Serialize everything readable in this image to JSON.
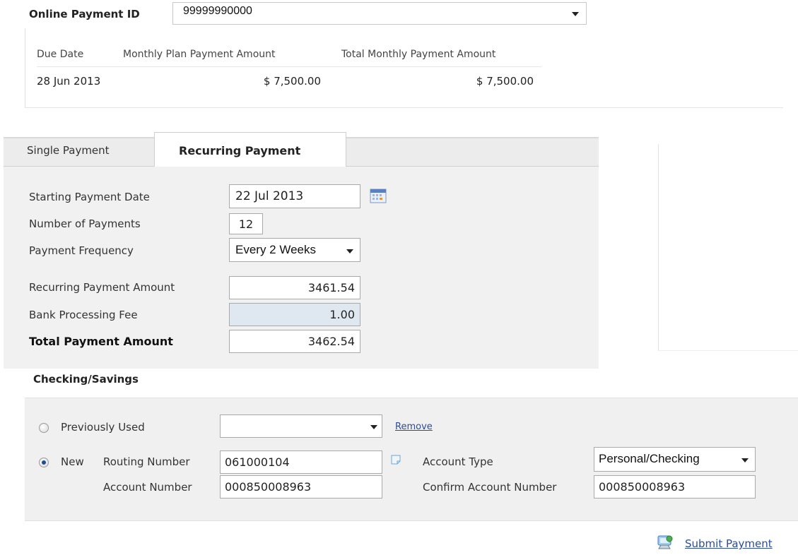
{
  "header": {
    "pid_label": "Online Payment ID",
    "pid_value": "99999990000"
  },
  "due_table": {
    "columns": [
      "Due Date",
      "Monthly Plan Payment Amount",
      "Total Monthly Payment Amount"
    ],
    "rows": [
      [
        "28 Jun 2013",
        "$ 7,500.00",
        "$ 7,500.00"
      ]
    ]
  },
  "tabs": [
    {
      "label": "Single Payment",
      "active": false
    },
    {
      "label": "Recurring Payment",
      "active": true
    }
  ],
  "recurring": {
    "start_label": "Starting Payment Date",
    "start_value": "22 Jul 2013",
    "count_label": "Number of Payments",
    "count_value": "12",
    "freq_label": "Payment Frequency",
    "freq_value": "Every 2 Weeks",
    "amount_label": "Recurring Payment Amount",
    "amount_value": "3461.54",
    "fee_label": "Bank Processing Fee",
    "fee_value": "1.00",
    "total_label": "Total Payment Amount",
    "total_value": "3462.54"
  },
  "checking": {
    "title": "Checking/Savings",
    "previous_label": "Previously Used",
    "previous_value": "",
    "remove_link": "Remove",
    "new_label": "New",
    "routing_label": "Routing Number",
    "routing_value": "061000104",
    "account_label": "Account Number",
    "account_value": "000850008963",
    "type_label": "Account Type",
    "type_value": "Personal/Checking",
    "confirm_label": "Confirm Account Number",
    "confirm_value": "000850008963",
    "selected": "New"
  },
  "submit_label": "Submit Payment",
  "icons": [
    "calendar-icon",
    "routing-help-icon",
    "submit-payment-icon",
    "chevron-down-icon"
  ],
  "colors": {
    "link": "#2b4c9b",
    "radio_selected": "#1d4f8f",
    "readonly_field": "#dfe8f0"
  }
}
